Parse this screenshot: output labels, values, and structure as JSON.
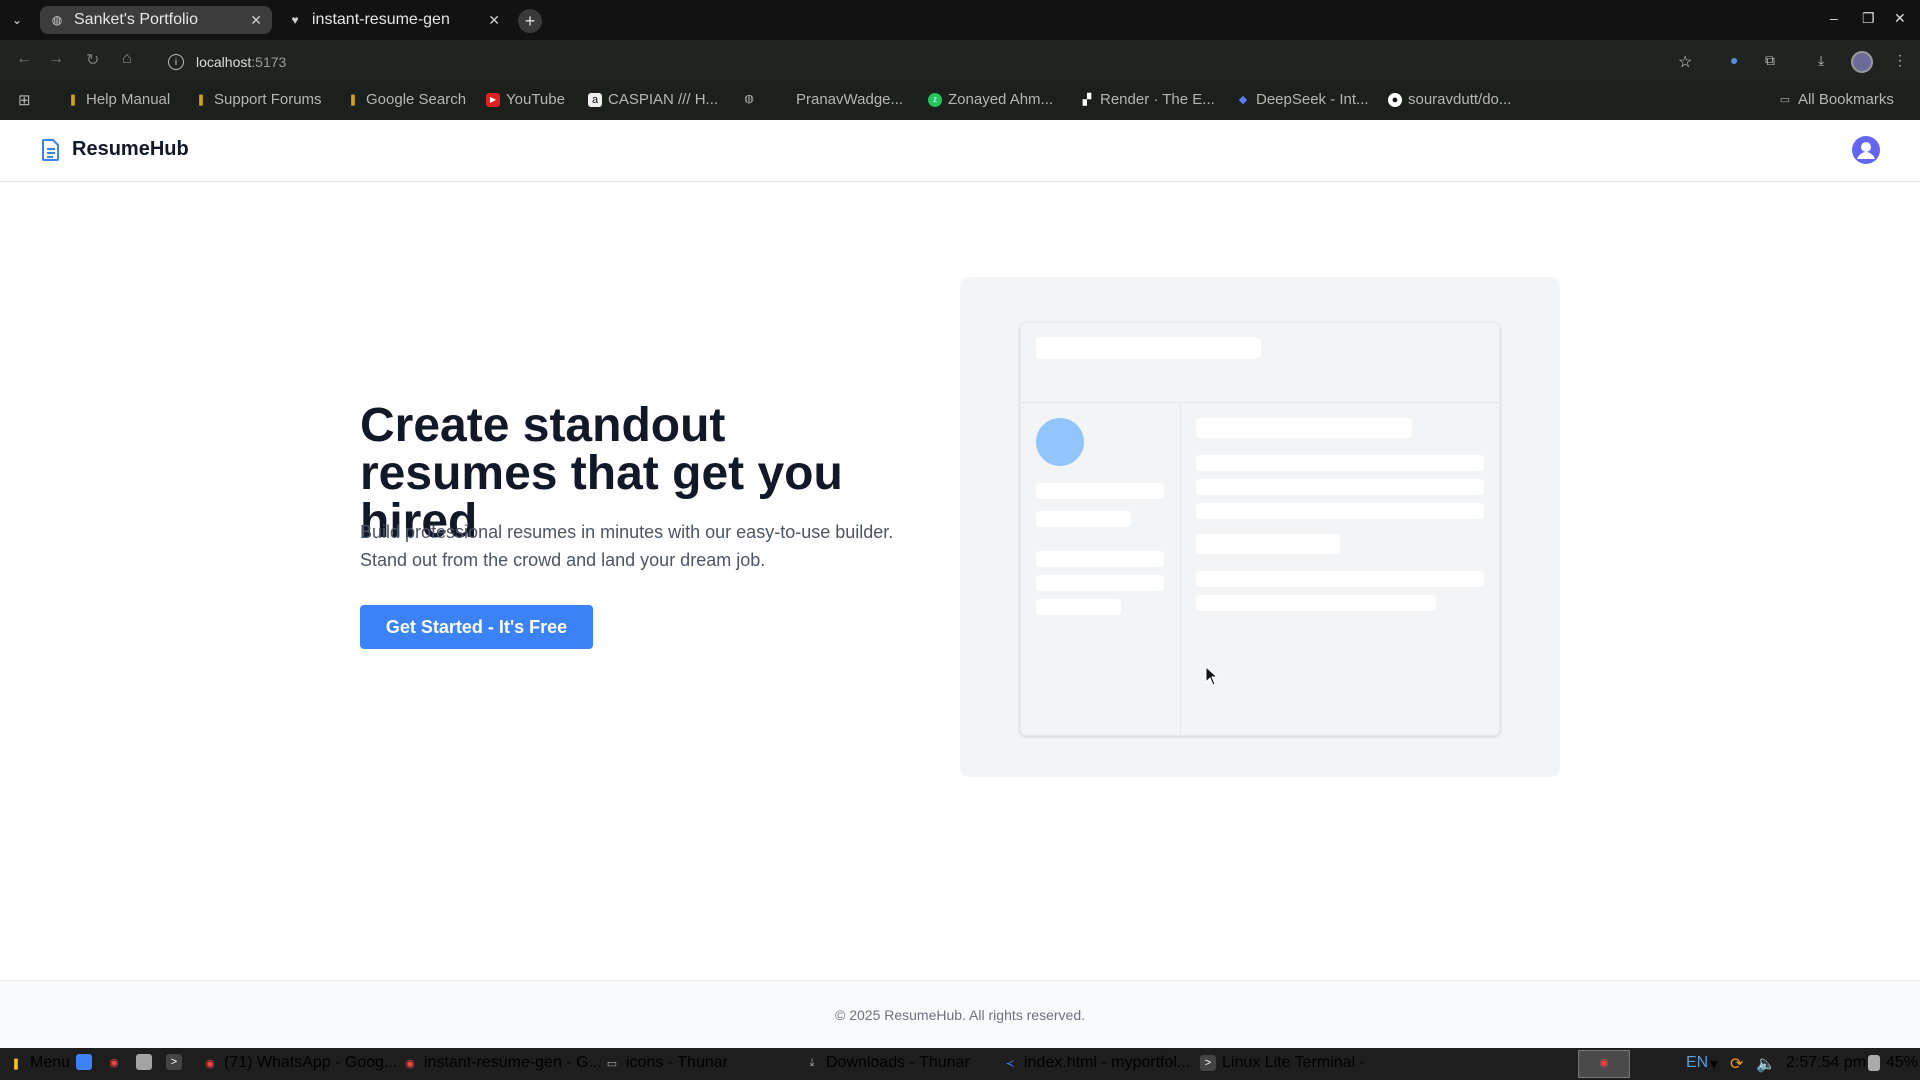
{
  "browser": {
    "tabs": [
      {
        "title": "Sanket's Portfolio",
        "active": false
      },
      {
        "title": "instant-resume-gen",
        "active": true
      }
    ],
    "url_host": "localhost",
    "url_port": ":5173",
    "bookmarks": [
      "Help Manual",
      "Support Forums",
      "Google Search",
      "YouTube",
      "CASPIAN /// H...",
      "PranavWadge...",
      "Zonayed Ahm...",
      "Render · The E...",
      "DeepSeek - Int...",
      "souravdutt/do..."
    ],
    "all_bookmarks": "All Bookmarks"
  },
  "app": {
    "brand": "ResumeHub",
    "hero": {
      "title": "Create standout resumes that get you hired",
      "subtitle": "Build professional resumes in minutes with our easy-to-use builder. Stand out from the crowd and land your dream job.",
      "cta": "Get Started - It's Free"
    },
    "footer": "© 2025 ResumeHub. All rights reserved.",
    "colors": {
      "accent": "#3b82f6",
      "avatar": "#6366f1",
      "placeholder_circle": "#93c5fd"
    }
  },
  "taskbar": {
    "menu": "Menu",
    "items": [
      "(71) WhatsApp - Goog...",
      "instant-resume-gen - G...",
      "icons - Thunar",
      "Downloads - Thunar",
      "index.html - myportfol...",
      "Linux Lite Terminal -"
    ],
    "lang": "EN",
    "clock": "2:57:54 pm",
    "battery": "45%"
  }
}
